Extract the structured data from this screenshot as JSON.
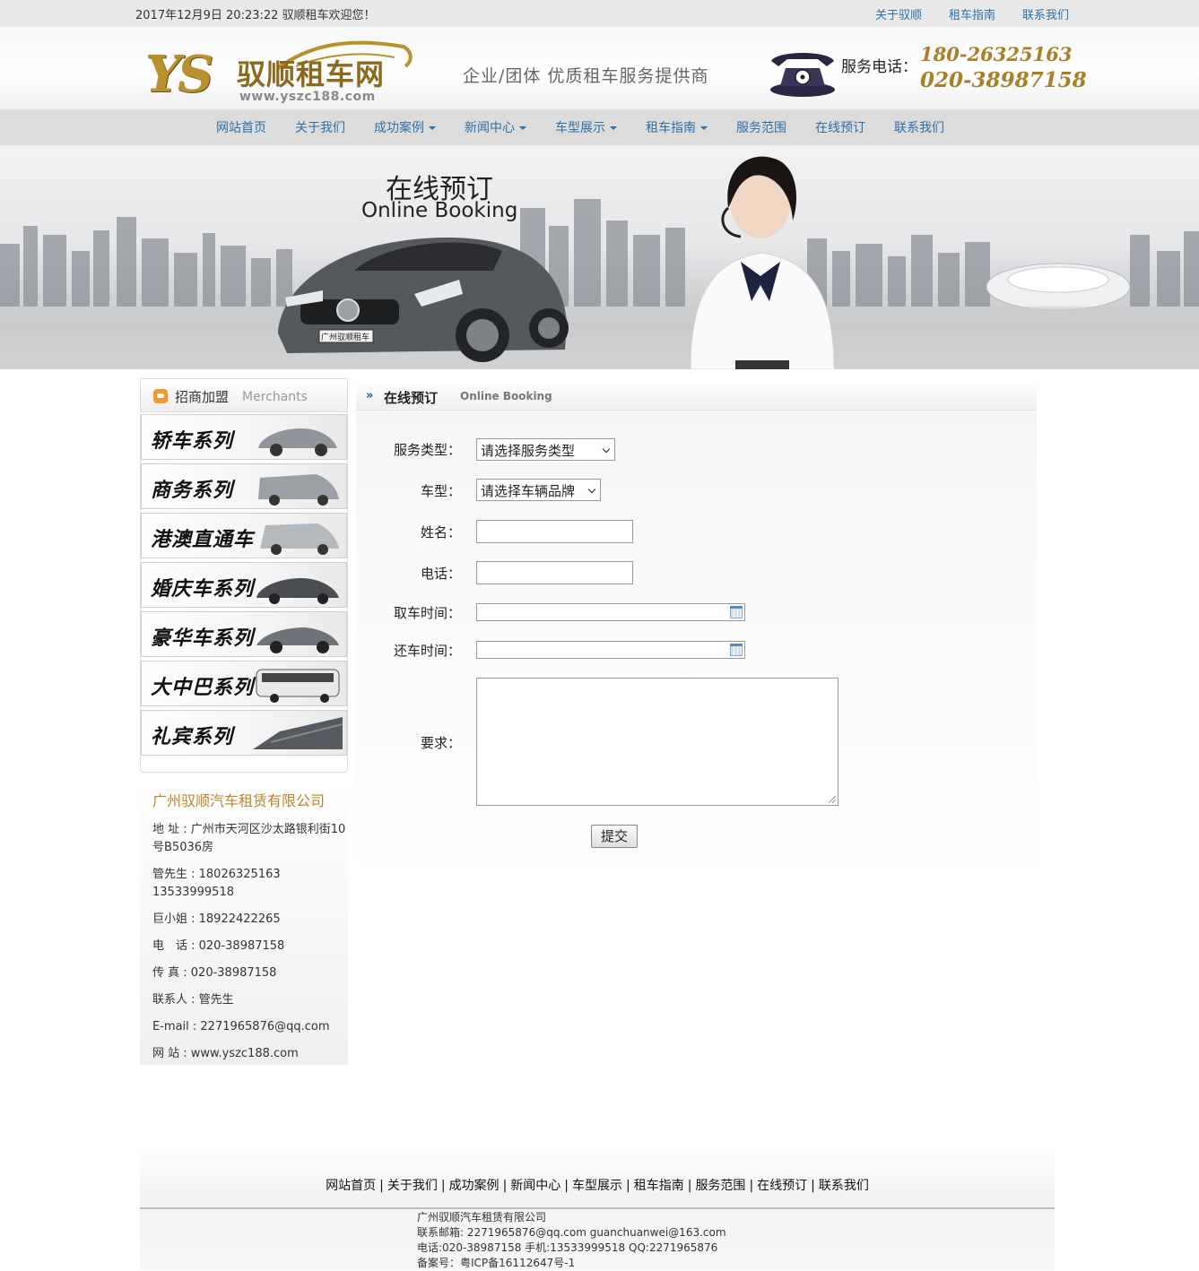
{
  "topbar": {
    "datetime": "2017年12月9日 20:23:22 驭顺租车欢迎您！",
    "links": [
      "关于驭顺",
      "租车指南",
      "联系我们"
    ]
  },
  "header": {
    "logo_mark": "YS",
    "logo_name": "驭顺租车网",
    "logo_url": "www.yszc188.com",
    "slogan": "企业/团体  优质租车服务提供商",
    "phone_label": "服务电话：",
    "phone1": "180-26325163",
    "phone2": "020-38987158"
  },
  "nav": {
    "items": [
      {
        "label": "网站首页",
        "dropdown": false
      },
      {
        "label": "关于我们",
        "dropdown": false
      },
      {
        "label": "成功案例",
        "dropdown": true
      },
      {
        "label": "新闻中心",
        "dropdown": true
      },
      {
        "label": "车型展示",
        "dropdown": true
      },
      {
        "label": "租车指南",
        "dropdown": true
      },
      {
        "label": "服务范围",
        "dropdown": false
      },
      {
        "label": "在线预订",
        "dropdown": false
      },
      {
        "label": "联系我们",
        "dropdown": false
      }
    ]
  },
  "banner": {
    "title_cn": "在线预订",
    "title_en": "Online Booking",
    "plate": "广州驭顺租车"
  },
  "sidebar": {
    "head_cn": "招商加盟",
    "head_en": "Merchants",
    "series": [
      "轿车系列",
      "商务系列",
      "港澳直通车",
      "婚庆车系列",
      "豪华车系列",
      "大中巴系列",
      "礼宾系列"
    ],
    "company_name": "广州驭顺汽车租赁有限公司",
    "address": "地 址 : 广州市天河区沙太路银利街10号B5036房",
    "contact1": "管先生 : 18026325163 13533999518",
    "contact2": "巨小姐 : 18922422265",
    "tel": "电　话 : 020-38987158",
    "fax": "传 真 : 020-38987158",
    "person": "联系人 : 管先生",
    "email": "E-mail : 2271965876@qq.com",
    "site": "网 站 : www.yszc188.com"
  },
  "content": {
    "head_cn": "在线预订",
    "head_en": "Online Booking",
    "form": {
      "service_label": "服务类型：",
      "service_value": "请选择服务类型",
      "car_label": "车型：",
      "car_value": "请选择车辆品牌",
      "name_label": "姓名：",
      "phone_label": "电话：",
      "pickup_label": "取车时间：",
      "return_label": "还车时间：",
      "req_label": "要求：",
      "submit": "提交"
    }
  },
  "footer": {
    "links": [
      "网站首页",
      "关于我们",
      "成功案例",
      "新闻中心",
      "车型展示",
      "租车指南",
      "服务范围",
      "在线预订",
      "联系我们"
    ],
    "company": "广州驭顺汽车租赁有限公司",
    "emails": "联系邮箱: 2271965876@qq.com guanchuanwei@163.com",
    "phones": "电话:020-38987158 手机:13533999518 QQ:2271965876",
    "icp": "备案号：粤ICP备16112647号-1"
  },
  "colors": {
    "link_blue": "#2e6fa6",
    "gold": "#b8912e",
    "nav_bg": "#dcdcdc"
  }
}
